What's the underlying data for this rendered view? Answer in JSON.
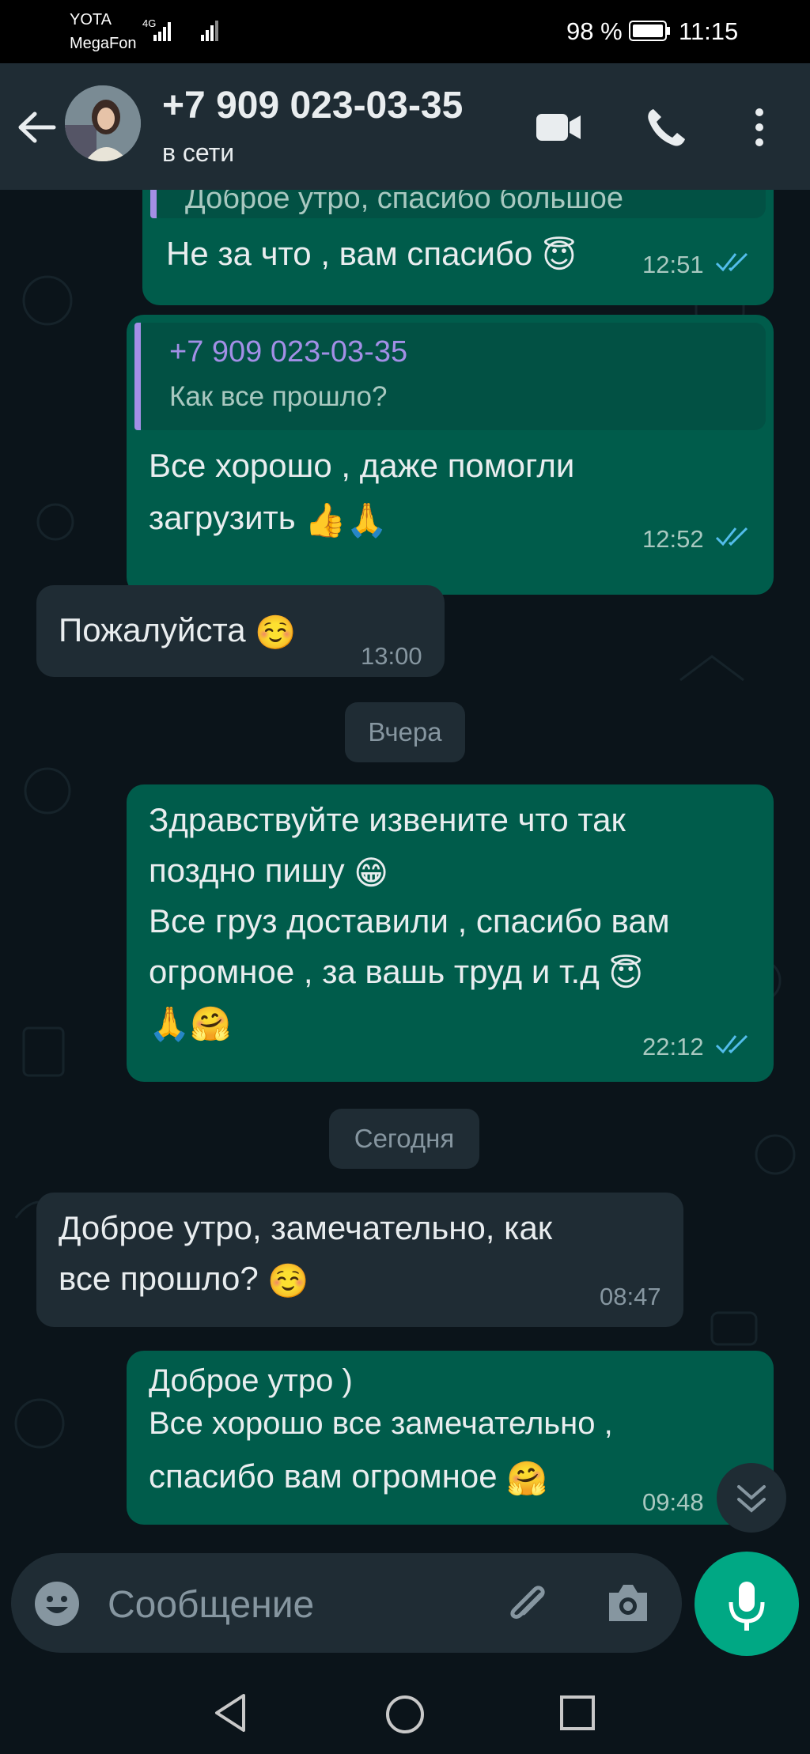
{
  "status_bar": {
    "operator1": "YOTA",
    "operator2": "MegaFon",
    "network": "4G",
    "battery": "98 %",
    "time": "11:15"
  },
  "header": {
    "contact": "+7 909 023-03-35",
    "status": "в сети",
    "icons": [
      "back-arrow-icon",
      "video-call-icon",
      "phone-icon",
      "more-vert-icon"
    ]
  },
  "messages": [
    {
      "direction": "out",
      "quote_text": "Доброе утро, спасибо большое",
      "text": "Не за что , вам спасибо",
      "emoji": "😇",
      "time": "12:51",
      "read": true
    },
    {
      "direction": "out",
      "quote_name": "+7 909 023-03-35",
      "quote_text": "Как все прошло?",
      "lines": [
        "Все хорошо , даже помогли",
        "загрузить"
      ],
      "emoji": "👍🙏",
      "time": "12:52",
      "read": true
    },
    {
      "direction": "in",
      "text": "Пожалуйста",
      "emoji": "☺️",
      "time": "13:00"
    },
    {
      "date_divider": "Вчера"
    },
    {
      "direction": "out",
      "lines": [
        "Здравствуйте извените что так",
        "поздно пишу",
        "Все груз доставили , спасибо вам",
        "огромное , за вашь труд и т.д"
      ],
      "emoji_line2": "😁",
      "emoji_line4": "😇",
      "emoji_last": "🙏🤗",
      "time": "22:12",
      "read": true
    },
    {
      "date_divider": "Сегодня"
    },
    {
      "direction": "in",
      "lines": [
        "Доброе утро, замечательно, как",
        "все прошло?"
      ],
      "emoji": "☺️",
      "time": "08:47"
    },
    {
      "direction": "out",
      "lines": [
        "Доброе утро )",
        "Все хорошо все замечательно ,",
        "спасибо вам огромное"
      ],
      "emoji": "🤗",
      "time": "09:48"
    }
  ],
  "input": {
    "placeholder": "Сообщение",
    "icons": [
      "emoji-icon",
      "attach-icon",
      "camera-icon",
      "mic-icon"
    ]
  },
  "nav": {
    "icons": [
      "nav-back-icon",
      "nav-home-icon",
      "nav-recents-icon"
    ]
  },
  "colors": {
    "background": "#0b141a",
    "header": "#1f2c34",
    "outgoing": "#005c4b",
    "incoming": "#1f2c34",
    "accent": "#00a884",
    "read_ticks": "#53bdeb",
    "quote_name": "#a38fe6"
  }
}
